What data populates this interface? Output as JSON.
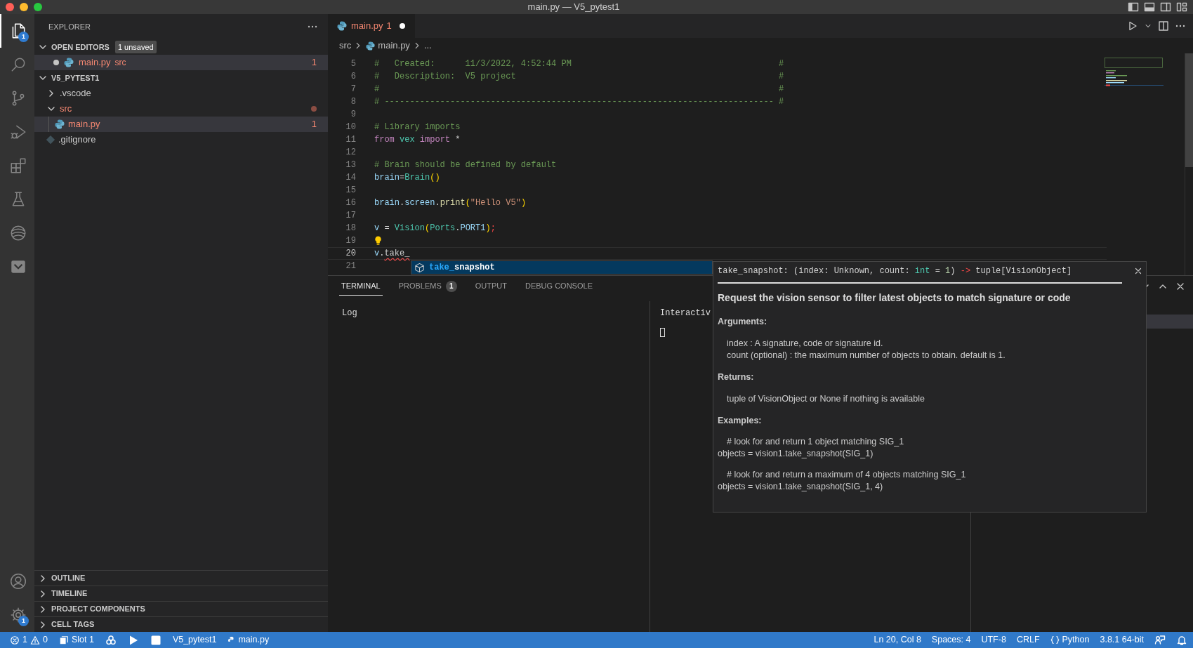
{
  "window": {
    "title": "main.py — V5_pytest1"
  },
  "activity_bar": {
    "items": [
      {
        "selected": true,
        "badge": "1"
      },
      {
        "selected": false
      },
      {
        "selected": false
      },
      {
        "selected": false
      },
      {
        "selected": false
      },
      {
        "selected": false
      },
      {
        "selected": false
      },
      {
        "selected": false
      }
    ],
    "bottom_items": [
      {
        "selected": false
      },
      {
        "selected": false,
        "badge": "1"
      }
    ]
  },
  "sidebar": {
    "title": "EXPLORER",
    "open_editors": {
      "title": "OPEN EDITORS",
      "expanded": true,
      "badge": "1 unsaved",
      "items": [
        {
          "name": "main.py",
          "folder": "src",
          "problems": "1",
          "modified": true,
          "error": true,
          "selected": true
        }
      ]
    },
    "workspace": {
      "title": "V5_PYTEST1",
      "expanded": true,
      "tree": [
        {
          "name": ".vscode",
          "kind": "folder",
          "expanded": false,
          "error": false,
          "selected": false
        },
        {
          "name": "src",
          "kind": "folder",
          "expanded": true,
          "error": true,
          "selected": false,
          "children": [
            {
              "name": "main.py",
              "kind": "python",
              "error": true,
              "problems": "1",
              "selected": true
            }
          ]
        },
        {
          "name": ".gitignore",
          "kind": "git",
          "error": false,
          "selected": false
        }
      ]
    },
    "collapsed_sections": [
      {
        "title": "OUTLINE",
        "expanded": false
      },
      {
        "title": "TIMELINE",
        "expanded": false
      },
      {
        "title": "PROJECT COMPONENTS",
        "expanded": false
      },
      {
        "title": "CELL TAGS",
        "expanded": false
      }
    ]
  },
  "editor": {
    "tabs": [
      {
        "label": "main.py",
        "problems": "1",
        "modified": true,
        "error": true,
        "selected": true
      }
    ],
    "breadcrumb": [
      {
        "text": "src",
        "kind": "folder"
      },
      {
        "text": "main.py",
        "kind": "python"
      },
      {
        "text": "...",
        "kind": "symbol"
      }
    ],
    "lines": [
      {
        "number": "5",
        "current": false,
        "lightbulb": false,
        "tokens": [
          {
            "kind": "comment",
            "text": "#   Created:      11/3/2022, 4:52:44 PM"
          }
        ],
        "end_mark": "#"
      },
      {
        "number": "6",
        "current": false,
        "lightbulb": false,
        "tokens": [
          {
            "kind": "comment",
            "text": "#   Description:  V5 project"
          }
        ],
        "end_mark": "#"
      },
      {
        "number": "7",
        "current": false,
        "lightbulb": false,
        "tokens": [
          {
            "kind": "comment",
            "text": "#"
          }
        ],
        "end_mark": "#"
      },
      {
        "number": "8",
        "current": false,
        "lightbulb": false,
        "tokens": [
          {
            "kind": "comment",
            "text": "# -----------------------------------------------------------------------------"
          }
        ],
        "end_mark": "#"
      },
      {
        "number": "9",
        "current": false,
        "lightbulb": false
      },
      {
        "number": "10",
        "current": false,
        "lightbulb": false,
        "tokens": [
          {
            "kind": "comment",
            "text": "# Library imports"
          }
        ]
      },
      {
        "number": "11",
        "current": false,
        "lightbulb": false,
        "tokens": [
          {
            "kind": "keyword",
            "text": "from "
          },
          {
            "kind": "type",
            "text": "vex "
          },
          {
            "kind": "keyword",
            "text": "import"
          },
          {
            "kind": "plain",
            "text": " *"
          }
        ]
      },
      {
        "number": "12",
        "current": false,
        "lightbulb": false
      },
      {
        "number": "13",
        "current": false,
        "lightbulb": false,
        "tokens": [
          {
            "kind": "comment",
            "text": "# Brain should be defined by default"
          }
        ]
      },
      {
        "number": "14",
        "current": false,
        "lightbulb": false,
        "tokens": [
          {
            "kind": "var",
            "text": "brain"
          },
          {
            "kind": "plain",
            "text": "="
          },
          {
            "kind": "type",
            "text": "Brain"
          },
          {
            "kind": "bracket",
            "text": "()"
          }
        ]
      },
      {
        "number": "15",
        "current": false,
        "lightbulb": false
      },
      {
        "number": "16",
        "current": false,
        "lightbulb": false,
        "tokens": [
          {
            "kind": "var",
            "text": "brain"
          },
          {
            "kind": "plain",
            "text": "."
          },
          {
            "kind": "var",
            "text": "screen"
          },
          {
            "kind": "plain",
            "text": "."
          },
          {
            "kind": "func",
            "text": "print"
          },
          {
            "kind": "bracket",
            "text": "("
          },
          {
            "kind": "string",
            "text": "\"Hello V5\""
          },
          {
            "kind": "bracket",
            "text": ")"
          }
        ]
      },
      {
        "number": "17",
        "current": false,
        "lightbulb": false
      },
      {
        "number": "18",
        "current": false,
        "lightbulb": false,
        "tokens": [
          {
            "kind": "var",
            "text": "v"
          },
          {
            "kind": "plain",
            "text": " = "
          },
          {
            "kind": "type",
            "text": "Vision"
          },
          {
            "kind": "bracket",
            "text": "("
          },
          {
            "kind": "type",
            "text": "Ports"
          },
          {
            "kind": "plain",
            "text": "."
          },
          {
            "kind": "var",
            "text": "PORT1"
          },
          {
            "kind": "bracket",
            "text": ")"
          },
          {
            "kind": "error_punct",
            "text": ";"
          }
        ]
      },
      {
        "number": "19",
        "current": false,
        "lightbulb": true
      },
      {
        "number": "20",
        "current": true,
        "lightbulb": false,
        "tokens": [
          {
            "kind": "var",
            "text": "v"
          },
          {
            "kind": "plain",
            "text": "."
          },
          {
            "kind": "error_ident",
            "text": "take_"
          }
        ]
      },
      {
        "number": "21",
        "current": false,
        "lightbulb": false
      }
    ]
  },
  "suggest": {
    "items": [
      {
        "match": "take_",
        "rest": "snapshot",
        "selected": true
      }
    ]
  },
  "hover": {
    "signature": [
      {
        "kind": "plain",
        "text": "take_snapshot: (index: Unknown, count: "
      },
      {
        "kind": "type",
        "text": "int"
      },
      {
        "kind": "plain",
        "text": " = "
      },
      {
        "kind": "number",
        "text": "1"
      },
      {
        "kind": "plain",
        "text": ") "
      },
      {
        "kind": "arrow",
        "text": "->"
      },
      {
        "kind": "plain",
        "text": " tuple[VisionObject]"
      }
    ],
    "heading": "Request the vision sensor to filter latest objects to match signature or code",
    "blocks": [
      {
        "kind": "label",
        "text": "Arguments:"
      },
      {
        "kind": "paragraph",
        "lines": [
          {
            "indent": true,
            "text": "index : A signature, code or signature id."
          },
          {
            "indent": true,
            "text": "count (optional) : the maximum number of objects to obtain. default is 1."
          }
        ]
      },
      {
        "kind": "label",
        "text": "Returns:"
      },
      {
        "kind": "paragraph",
        "lines": [
          {
            "indent": true,
            "text": "tuple of VisionObject or None if nothing is available"
          }
        ]
      },
      {
        "kind": "label",
        "text": "Examples:"
      },
      {
        "kind": "paragraph",
        "lines": [
          {
            "indent": true,
            "text": "# look for and return 1 object matching SIG_1"
          },
          {
            "indent": false,
            "text": "objects = vision1.take_snapshot(SIG_1)"
          }
        ]
      },
      {
        "kind": "paragraph",
        "lines": [
          {
            "indent": true,
            "text": "# look for and return a maximum of 4 objects matching SIG_1"
          },
          {
            "indent": false,
            "text": "objects = vision1.take_snapshot(SIG_1, 4)"
          }
        ]
      }
    ]
  },
  "panel": {
    "tabs": [
      {
        "label": "TERMINAL",
        "selected": true
      },
      {
        "label": "PROBLEMS",
        "badge": "1",
        "selected": false
      },
      {
        "label": "OUTPUT",
        "selected": false
      },
      {
        "label": "DEBUG CONSOLE",
        "selected": false
      }
    ],
    "log": {
      "title": "Log"
    },
    "interactive": {
      "title": "Interactiv",
      "cursor": true
    },
    "terminal_list": {
      "selected": true
    }
  },
  "status_bar": {
    "left": [
      {
        "kind": "problems",
        "errors": "1",
        "warnings": "0"
      },
      {
        "kind": "slot",
        "text": "Slot 1"
      },
      {
        "kind": "cluster"
      },
      {
        "kind": "play"
      },
      {
        "kind": "stop"
      },
      {
        "kind": "text",
        "text": "V5_pytest1"
      },
      {
        "kind": "python_file",
        "text": "main.py"
      }
    ],
    "right": [
      {
        "kind": "text",
        "text": "Ln 20, Col 8"
      },
      {
        "kind": "text",
        "text": "Spaces: 4"
      },
      {
        "kind": "text",
        "text": "UTF-8"
      },
      {
        "kind": "text",
        "text": "CRLF"
      },
      {
        "kind": "language",
        "text": "Python"
      },
      {
        "kind": "text",
        "text": "3.8.1 64-bit"
      },
      {
        "kind": "feedback"
      },
      {
        "kind": "bell"
      }
    ]
  }
}
